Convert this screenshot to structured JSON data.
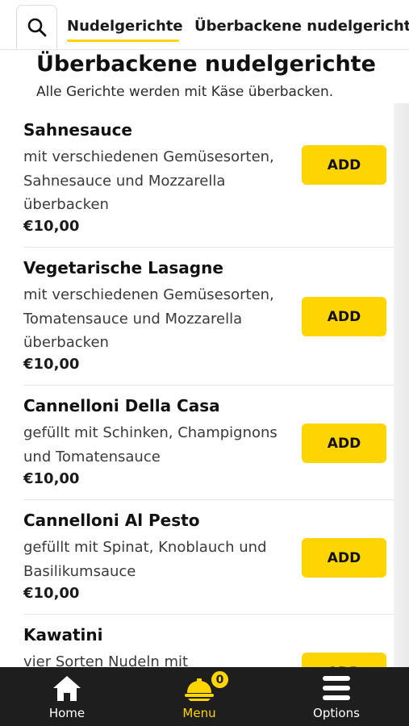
{
  "tabs": {
    "active": "Nudelgerichte",
    "next": "Überbackene nudelgerichte"
  },
  "section": {
    "title": "Überbackene nudelgerichte",
    "subtitle": "Alle Gerichte werden mit Käse überbacken."
  },
  "items": [
    {
      "name": "Sahnesauce",
      "desc_lines": [
        "mit verschiedenen Gemüsesorten,",
        "Sahnesauce und Mozzarella",
        "überbacken"
      ],
      "price": "€10,00",
      "button": "ADD"
    },
    {
      "name": "Vegetarische Lasagne",
      "desc_lines": [
        "mit verschiedenen Gemüsesorten,",
        "Tomatensauce und Mozzarella",
        "überbacken"
      ],
      "price": "€10,00",
      "button": "ADD"
    },
    {
      "name": "Cannelloni Della Casa",
      "desc_lines": [
        "gefüllt mit Schinken, Champignons",
        "und Tomatensauce"
      ],
      "price": "€10,00",
      "button": "ADD"
    },
    {
      "name": "Cannelloni Al Pesto",
      "desc_lines": [
        "gefüllt mit Spinat, Knoblauch und",
        "Basilikumsauce"
      ],
      "price": "€10,00",
      "button": "ADD"
    },
    {
      "name": "Kawatini",
      "desc_lines": [
        "vier Sorten Nudeln mit"
      ],
      "price": "",
      "button": "ADD"
    }
  ],
  "nav": {
    "home": "Home",
    "menu": "Menu",
    "options": "Options",
    "cart_count": "0"
  },
  "colors": {
    "accent": "#ffd500",
    "nav_bg": "#1e1e1e"
  },
  "icons": {
    "search": "search-icon",
    "home": "home-icon",
    "menu": "cloche-icon",
    "options": "hamburger-icon"
  }
}
